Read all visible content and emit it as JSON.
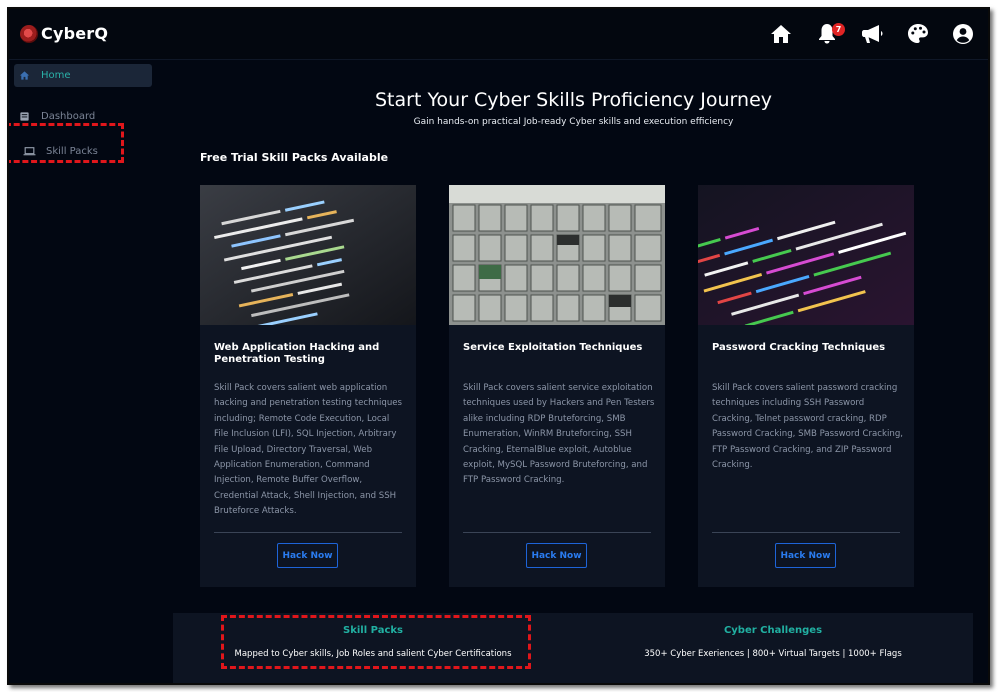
{
  "app": {
    "name": "CyberQ"
  },
  "header": {
    "icons": [
      "home-icon",
      "bell-icon",
      "megaphone-icon",
      "palette-icon",
      "account-icon"
    ],
    "notification_count": "7"
  },
  "sidebar": {
    "items": [
      {
        "label": "Home",
        "icon": "home-icon",
        "active": true
      },
      {
        "label": "Dashboard",
        "icon": "dashboard-icon",
        "active": false
      },
      {
        "label": "Skill Packs",
        "icon": "laptop-icon",
        "active": false
      }
    ]
  },
  "main": {
    "title": "Start Your Cyber Skills Proficiency Journey",
    "subtitle": "Gain hands-on practical Job-ready Cyber skills and execution efficiency",
    "section_label": "Free Trial Skill Packs Available",
    "cards": [
      {
        "title": "Web Application Hacking and Penetration Testing",
        "description": "Skill Pack covers salient web application hacking and penetration testing techniques including; Remote Code Execution, Local File Inclusion (LFI), SQL Injection, Arbitrary File Upload, Directory Traversal, Web Application Enumeration, Command Injection, Remote Buffer Overflow, Credential Attack, Shell Injection, and SSH Bruteforce Attacks.",
        "button": "Hack Now"
      },
      {
        "title": "Service Exploitation Techniques",
        "description": "Skill Pack covers salient service exploitation techniques used by Hackers and Pen Testers alike including RDP Bruteforcing, SMB Enumeration, WinRM Bruteforcing, SSH Cracking, EternalBlue exploit, Autoblue exploit, MySQL Password Bruteforcing, and FTP Password Cracking.",
        "button": "Hack Now"
      },
      {
        "title": "Password Cracking Techniques",
        "description": "Skill Pack covers salient password cracking techniques including SSH Password Cracking, Telnet password cracking, RDP Password Cracking, SMB Password Cracking, FTP Password Cracking, and ZIP Password Cracking.",
        "button": "Hack Now"
      }
    ]
  },
  "bottom": {
    "left": {
      "title": "Skill Packs",
      "subtitle": "Mapped to Cyber skills, Job Roles and salient Cyber Certifications"
    },
    "right": {
      "title": "Cyber Challenges",
      "subtitle": "350+ Cyber Exeriences | 800+ Virtual Targets | 1000+ Flags"
    }
  },
  "colors": {
    "accent": "#21b0a2",
    "button": "#2a7cf0",
    "highlight": "#e0161b",
    "background": "#020712",
    "card": "#0d1422"
  }
}
